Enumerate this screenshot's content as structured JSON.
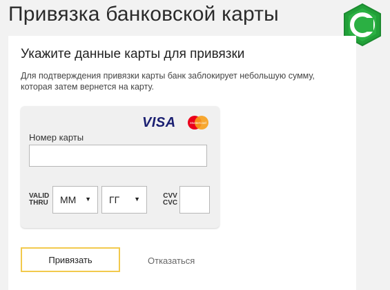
{
  "page": {
    "title": "Привязка банковской карты"
  },
  "form": {
    "heading": "Укажите данные карты для привязки",
    "description": "Для подтверждения привязки карты банк заблокирует небольшую сумму, которая затем вернется на карту.",
    "card": {
      "brand_visa": "VISA",
      "brand_mastercard": "MasterCard",
      "number_label": "Номер карты",
      "number_value": "",
      "valid_label_line1": "VALID",
      "valid_label_line2": "THRU",
      "month_value": "ММ",
      "year_value": "ГГ",
      "cvv_label_line1": "CVV",
      "cvv_label_line2": "CVC",
      "cvv_value": ""
    },
    "submit_label": "Привязать",
    "cancel_label": "Отказаться"
  },
  "colors": {
    "page_background": "#f2f2f2",
    "panel_background": "#ffffff",
    "card_background": "#f0f0f0",
    "submit_border": "#f2c94c",
    "visa_blue": "#1a1f71",
    "bank_green": "#21a038"
  },
  "icons": {
    "bank_logo": "sberbank-logo-icon",
    "dropdown_arrow": "triangle-down-icon"
  }
}
